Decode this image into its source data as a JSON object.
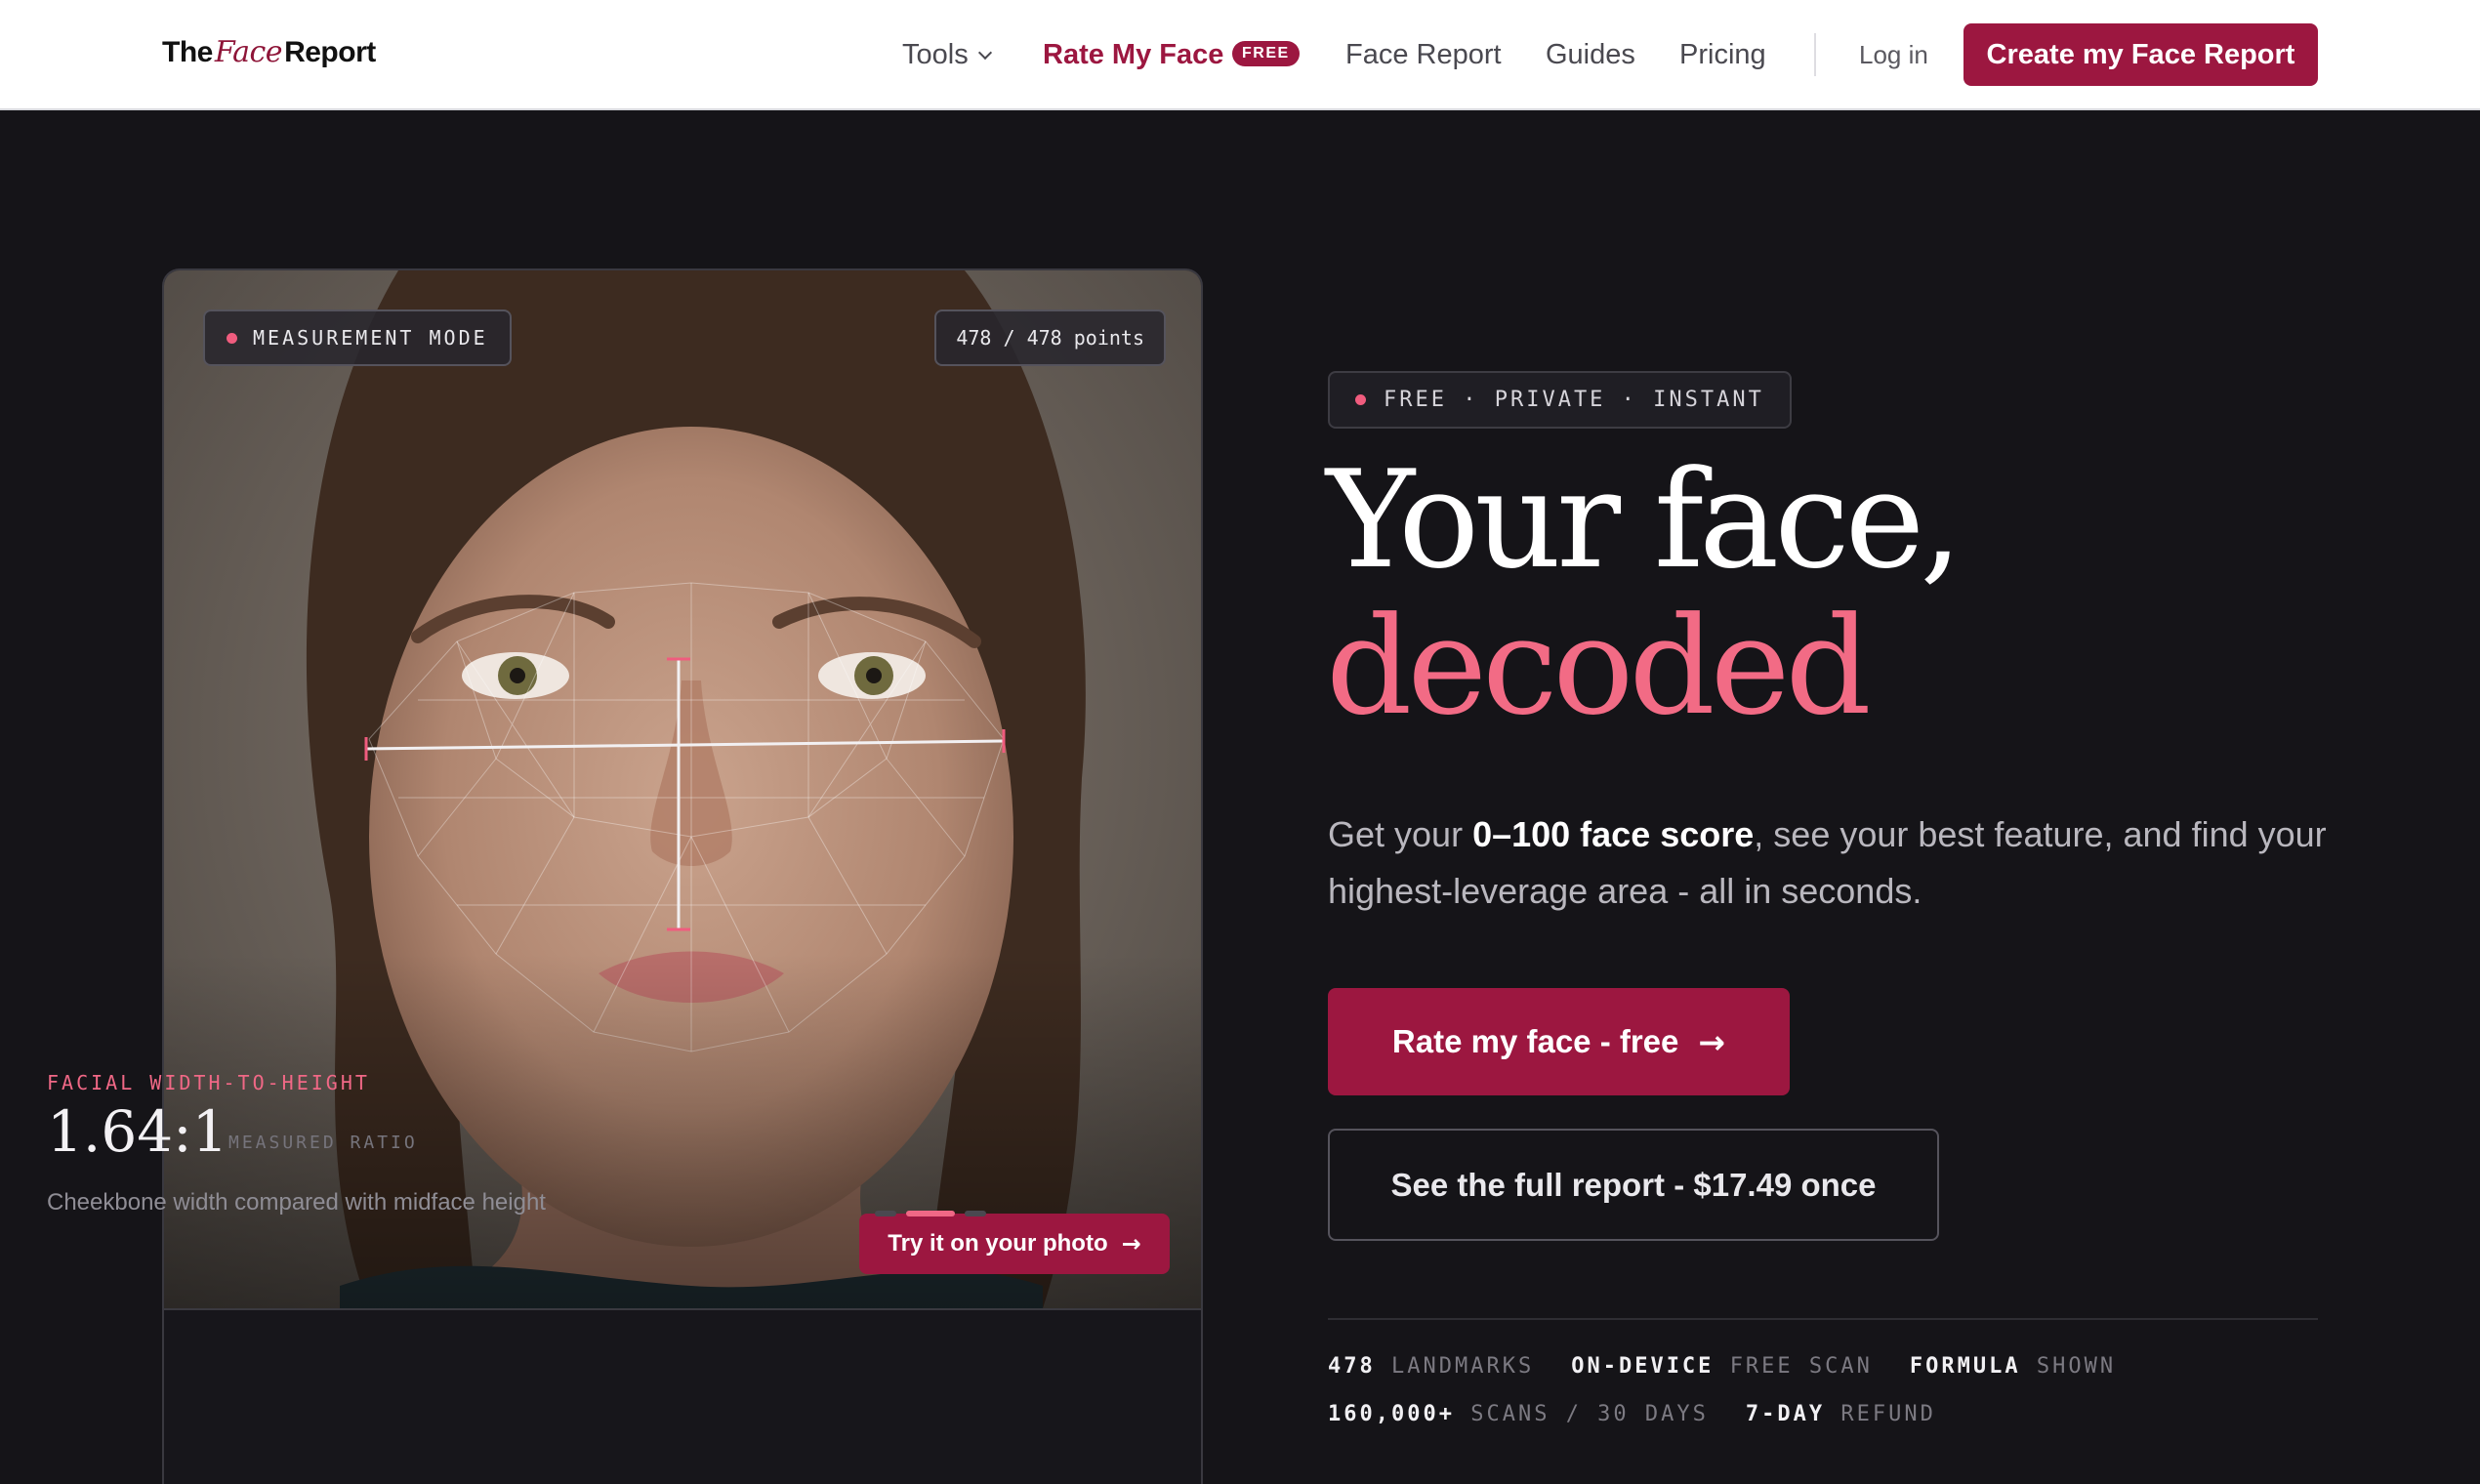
{
  "header": {
    "logo": {
      "pre": "The",
      "mid": "Face",
      "post": "Report"
    },
    "nav": {
      "tools": "Tools",
      "rate_my_face": "Rate My Face",
      "rate_badge": "FREE",
      "face_report": "Face Report",
      "guides": "Guides",
      "pricing": "Pricing",
      "login": "Log in"
    },
    "cta": "Create my Face Report"
  },
  "card": {
    "mode_label": "MEASUREMENT MODE",
    "points": "478 / 478 points",
    "try_button": "Try it on your photo",
    "metric_label": "FACIAL WIDTH-TO-HEIGHT",
    "metric_value": "1.64:1",
    "metric_unit": "MEASURED RATIO",
    "metric_desc": "Cheekbone width compared with midface height"
  },
  "hero": {
    "eyebrow": "FREE · PRIVATE · INSTANT",
    "title_line1": "Your face,",
    "title_line2": "decoded",
    "sub_pre": "Get your ",
    "sub_bold": "0–100 face score",
    "sub_post": ", see your best feature, and find your highest-leverage area - all in seconds.",
    "cta_primary": "Rate my face - free",
    "cta_secondary": "See the full report - $17.49 once"
  },
  "stats": {
    "row1": [
      {
        "bold": "478",
        "muted": "LANDMARKS"
      },
      {
        "bold": "ON-DEVICE",
        "muted": "FREE SCAN"
      },
      {
        "bold": "FORMULA",
        "muted": "SHOWN"
      }
    ],
    "row2": [
      {
        "bold": "160,000+",
        "muted": "SCANS / 30 DAYS"
      },
      {
        "bold": "7-DAY",
        "muted": "REFUND"
      }
    ]
  },
  "icons": {
    "chevron": "chevron-down-icon",
    "arrow": "arrow-right-icon",
    "status_dot": "status-dot-icon"
  },
  "colors": {
    "brand": "#9c1740",
    "accent": "#f26b85",
    "background": "#151418"
  }
}
